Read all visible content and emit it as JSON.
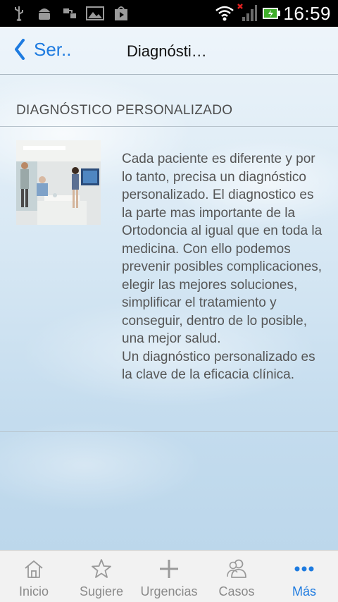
{
  "status_bar": {
    "time": "16:59",
    "icons": [
      "usb-icon",
      "android-debug-icon",
      "sync-icon",
      "image-icon",
      "play-store-icon",
      "wifi-icon",
      "signal-icon",
      "battery-icon"
    ]
  },
  "navbar": {
    "back_label": "Ser..",
    "title": "Diagnósti…"
  },
  "section": {
    "title": "DIAGNÓSTICO PERSONALIZADO",
    "body": "Cada paciente es diferente y por lo tanto, precisa un diagnóstico personalizado. El diagnostico es la parte mas importante de la Ortodoncia al igual que en toda la medicina. Con ello podemos prevenir posibles complicaciones, elegir las mejores soluciones, simplificar el tratamiento y conseguir, dentro de lo posible, una mejor salud.\nUn diagnóstico personalizado es la clave de la eficacia clínica."
  },
  "tabs": [
    {
      "label": "Inicio",
      "icon": "home-icon"
    },
    {
      "label": "Sugiere",
      "icon": "star-icon"
    },
    {
      "label": "Urgencias",
      "icon": "plus-icon"
    },
    {
      "label": "Casos",
      "icon": "people-icon"
    },
    {
      "label": "Más",
      "icon": "more-icon",
      "active": true
    }
  ],
  "colors": {
    "accent": "#1e7be0",
    "text": "#555555",
    "tab_inactive": "#8a8a8a"
  }
}
